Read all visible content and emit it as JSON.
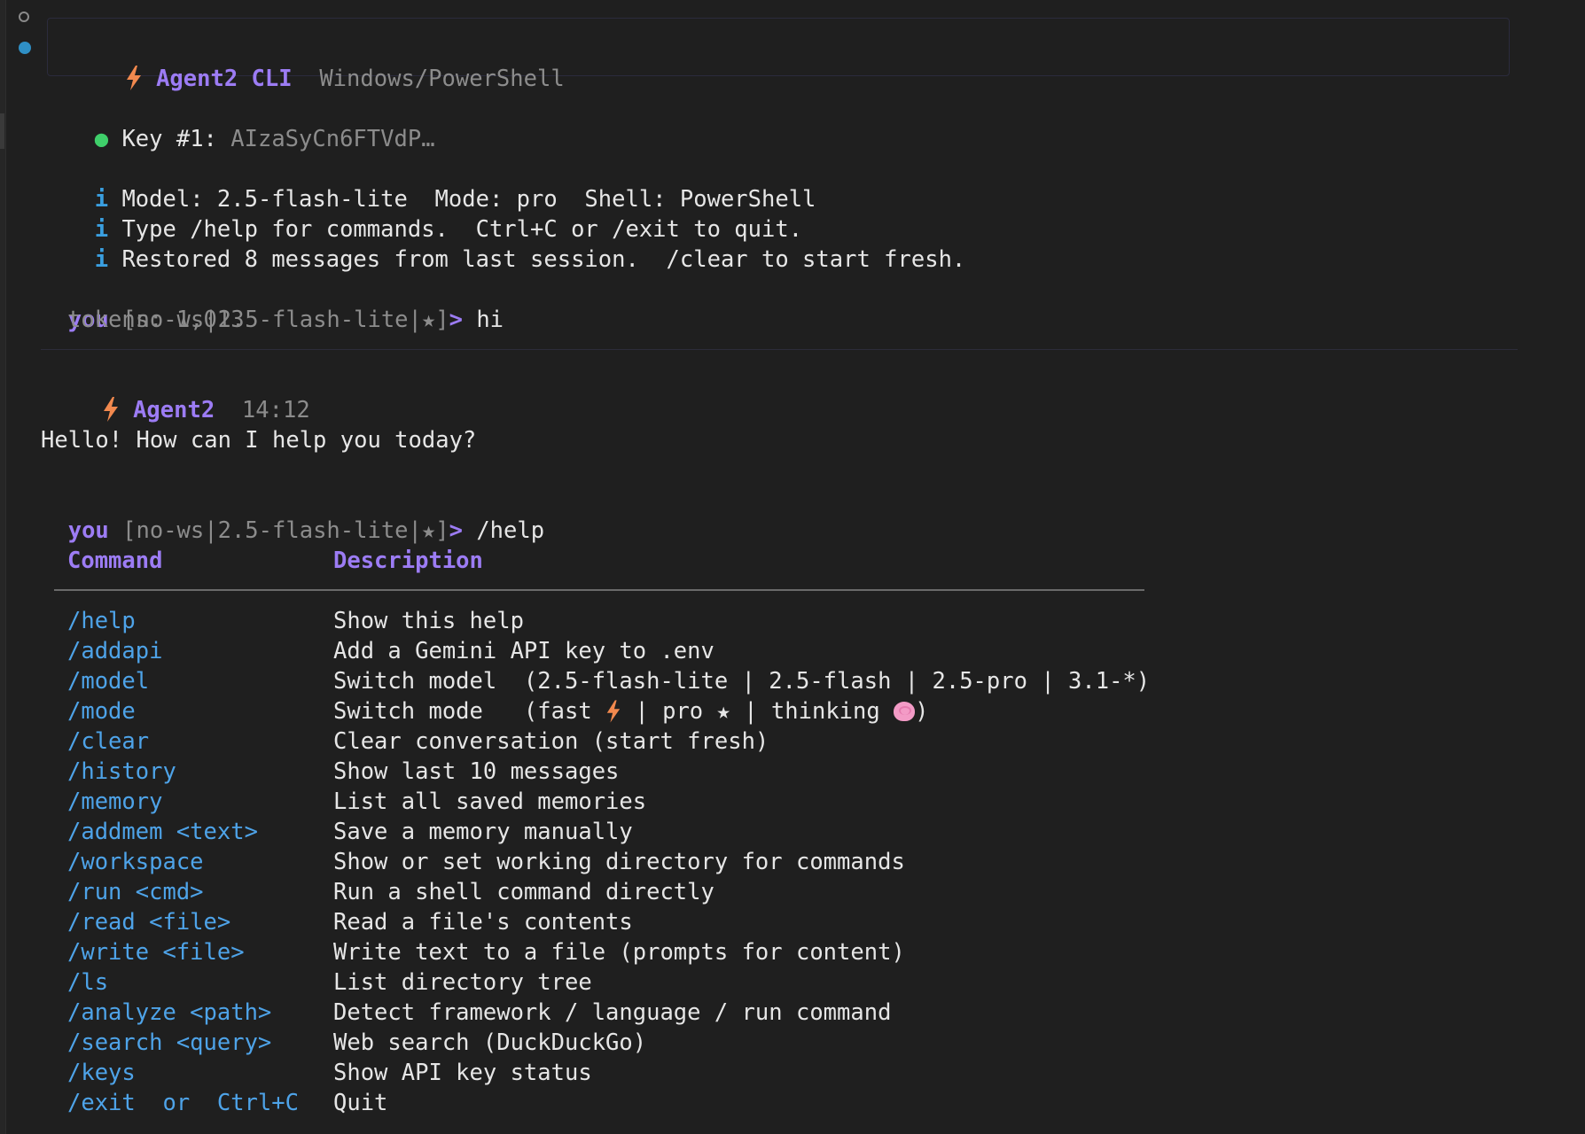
{
  "header": {
    "app_title": "Agent2 CLI",
    "platform": "Windows/PowerShell"
  },
  "key_status": {
    "label": "Key #1:",
    "value": "AIzaSyCn6FTVdP…"
  },
  "info_lines": [
    "Model: 2.5-flash-lite  Mode: pro  Shell: PowerShell",
    "Type /help for commands.  Ctrl+C or /exit to quit.",
    "Restored 8 messages from last session.  /clear to start fresh."
  ],
  "info_glyph": "i",
  "prompt1": {
    "user": "you",
    "context": "[no-ws|2.5-flash-lite|★]",
    "arrow": ">",
    "input": "hi"
  },
  "tokens_line": "tokens: 1,013",
  "agent_reply": {
    "name": "Agent2",
    "time": "14:12",
    "message": "Hello! How can I help you today?"
  },
  "prompt2": {
    "user": "you",
    "context": "[no-ws|2.5-flash-lite|★]",
    "arrow": ">",
    "input": "/help"
  },
  "help_table": {
    "headers": {
      "command": "Command",
      "description": "Description"
    },
    "rows": [
      {
        "command": "/help",
        "description": "Show this help"
      },
      {
        "command": "/addapi",
        "description": "Add a Gemini API key to .env"
      },
      {
        "command": "/model",
        "description": "Switch model  (2.5-flash-lite | 2.5-flash | 2.5-pro | 3.1-*)"
      },
      {
        "command": "/mode",
        "description_parts": {
          "a": "Switch mode   (fast ",
          "b": " | pro ★ | thinking ",
          "c": ")"
        }
      },
      {
        "command": "/clear",
        "description": "Clear conversation (start fresh)"
      },
      {
        "command": "/history",
        "description": "Show last 10 messages"
      },
      {
        "command": "/memory",
        "description": "List all saved memories"
      },
      {
        "command": "/addmem <text>",
        "description": "Save a memory manually"
      },
      {
        "command": "/workspace",
        "description": "Show or set working directory for commands"
      },
      {
        "command": "/run <cmd>",
        "description": "Run a shell command directly"
      },
      {
        "command": "/read <file>",
        "description": "Read a file's contents"
      },
      {
        "command": "/write <file>",
        "description": "Write text to a file (prompts for content)"
      },
      {
        "command": "/ls",
        "description": "List directory tree"
      },
      {
        "command": "/analyze <path>",
        "description": "Detect framework / language / run command"
      },
      {
        "command": "/search <query>",
        "description": "Web search (DuckDuckGo)"
      },
      {
        "command": "/keys",
        "description": "Show API key status"
      },
      {
        "command": "/exit  or  Ctrl+C",
        "description": "Quit"
      }
    ]
  },
  "icons": {
    "bolt": "lightning-bolt-icon",
    "brain": "brain-icon",
    "bullet": "green-dot-icon"
  },
  "colors": {
    "background": "#1f1f1f",
    "accent_purple": "#9c7cf4",
    "bolt_orange": "#f2894e",
    "command_blue": "#4ea3e8",
    "info_blue": "#3a9fe0",
    "status_green": "#3fcf6a"
  }
}
